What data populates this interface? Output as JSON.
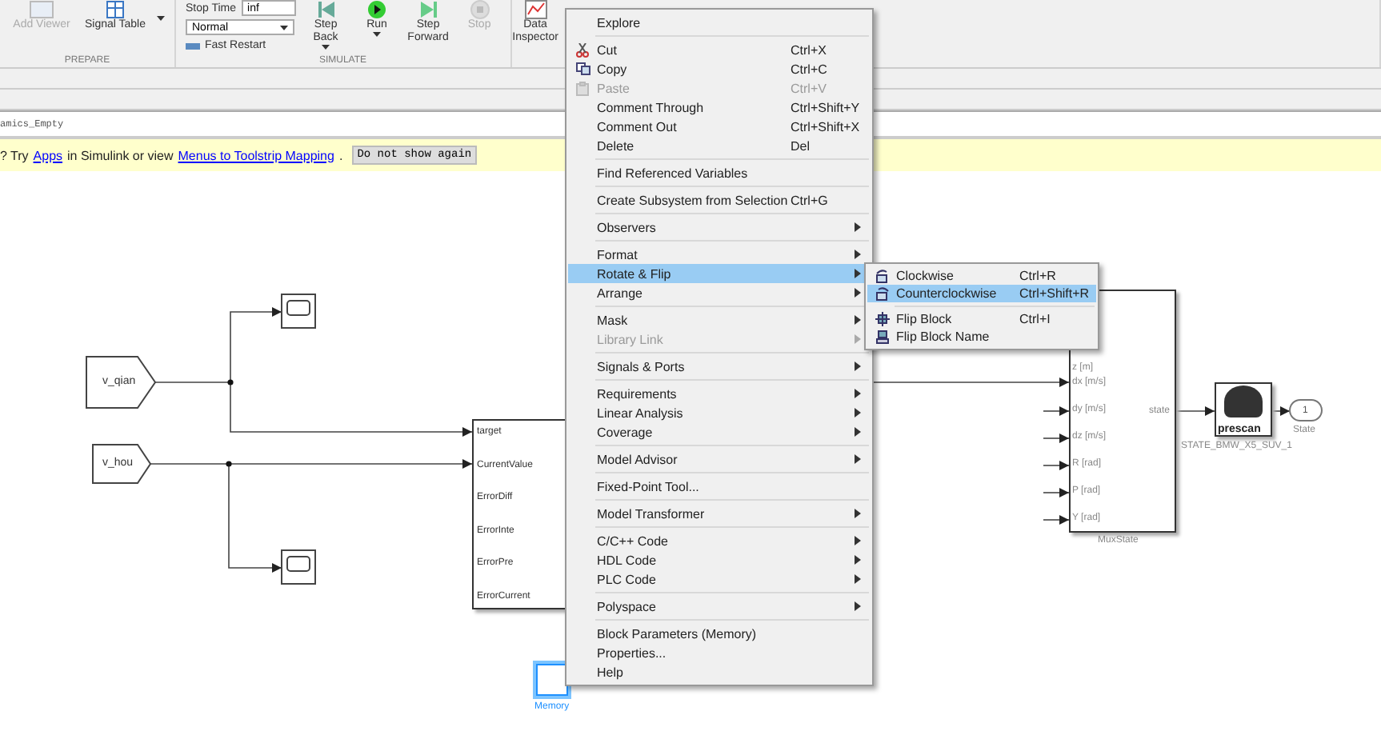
{
  "toolstrip": {
    "prepare": {
      "label": "PREPARE",
      "buttons": [
        {
          "label": "Add Viewer",
          "disabled": true,
          "kind": "viewer"
        },
        {
          "label": "Signal Table",
          "disabled": false,
          "kind": "table"
        }
      ]
    },
    "simulate": {
      "label": "SIMULATE",
      "stop_time_label": "Stop Time",
      "stop_time": "inf",
      "mode": "Normal",
      "fast_restart": "Fast Restart",
      "buttons": [
        {
          "label": "Step Back",
          "disabled": false,
          "kind": "back",
          "dropdown": true
        },
        {
          "label": "Run",
          "disabled": false,
          "kind": "run",
          "dropdown": true
        },
        {
          "label": "Step Forward",
          "disabled": false,
          "kind": "forward",
          "dropdown": false
        },
        {
          "label": "Stop",
          "disabled": true,
          "kind": "stop",
          "dropdown": false
        }
      ]
    },
    "review": {
      "buttons": [
        {
          "label": "Data Inspector",
          "disabled": false,
          "kind": "inspector"
        }
      ]
    }
  },
  "breadcrumb": "amics_Empty",
  "banner": {
    "before": "? Try",
    "link_1": "Apps",
    "middle": "in Simulink or view",
    "link_2": "Menus to Toolstrip Mapping",
    "after": ".",
    "button": "Do not show again"
  },
  "diagram": {
    "from_blocks": [
      {
        "label": "v_qian"
      },
      {
        "label": "v_hou"
      }
    ],
    "subsystem": {
      "ports": [
        "target",
        "CurrentValue",
        "ErrorDiff",
        "ErrorInte",
        "ErrorPre",
        "ErrorCurrent"
      ]
    },
    "memory": {
      "label": "Memory",
      "selected": true
    },
    "mux": {
      "label": "MuxState",
      "ports": [
        "z [m]",
        "dx [m/s]",
        "dy [m/s]",
        "dz [m/s]",
        "R [rad]",
        "P [rad]",
        "Y [rad]"
      ],
      "output": "state"
    },
    "prescan": {
      "logo": "prescan",
      "label": "STATE_BMW_X5_SUV_1"
    },
    "outport": {
      "number": "1",
      "label": "State"
    }
  },
  "context_menu": [
    [
      {
        "label": "Explore",
        "kind": "plain",
        "disabled": false,
        "submenu": false,
        "selected": false
      }
    ],
    [
      {
        "label": "Cut",
        "shortcut": "Ctrl+X",
        "kind": "cut",
        "disabled": false,
        "submenu": false,
        "selected": false
      },
      {
        "label": "Copy",
        "shortcut": "Ctrl+C",
        "kind": "copy",
        "disabled": false,
        "submenu": false,
        "selected": false
      },
      {
        "label": "Paste",
        "shortcut": "Ctrl+V",
        "kind": "paste",
        "disabled": true,
        "submenu": false,
        "selected": false
      },
      {
        "label": "Comment Through",
        "shortcut": "Ctrl+Shift+Y",
        "kind": "plain",
        "disabled": false,
        "submenu": false,
        "selected": false
      },
      {
        "label": "Comment Out",
        "shortcut": "Ctrl+Shift+X",
        "kind": "plain",
        "disabled": false,
        "submenu": false,
        "selected": false
      },
      {
        "label": "Delete",
        "shortcut": "Del",
        "kind": "plain",
        "disabled": false,
        "submenu": false,
        "selected": false
      }
    ],
    [
      {
        "label": "Find Referenced Variables",
        "kind": "plain",
        "disabled": false,
        "submenu": false,
        "selected": false
      }
    ],
    [
      {
        "label": "Create Subsystem from Selection",
        "shortcut": "Ctrl+G",
        "kind": "plain",
        "disabled": false,
        "submenu": false,
        "selected": false
      }
    ],
    [
      {
        "label": "Observers",
        "kind": "plain",
        "disabled": false,
        "submenu": true,
        "selected": false
      }
    ],
    [
      {
        "label": "Format",
        "kind": "plain",
        "disabled": false,
        "submenu": true,
        "selected": false
      },
      {
        "label": "Rotate & Flip",
        "kind": "plain",
        "disabled": false,
        "submenu": true,
        "selected": true
      },
      {
        "label": "Arrange",
        "kind": "plain",
        "disabled": false,
        "submenu": true,
        "selected": false
      }
    ],
    [
      {
        "label": "Mask",
        "kind": "plain",
        "disabled": false,
        "submenu": true,
        "selected": false
      },
      {
        "label": "Library Link",
        "kind": "plain",
        "disabled": true,
        "submenu": true,
        "selected": false
      }
    ],
    [
      {
        "label": "Signals & Ports",
        "kind": "plain",
        "disabled": false,
        "submenu": true,
        "selected": false
      }
    ],
    [
      {
        "label": "Requirements",
        "kind": "plain",
        "disabled": false,
        "submenu": true,
        "selected": false
      },
      {
        "label": "Linear Analysis",
        "kind": "plain",
        "disabled": false,
        "submenu": true,
        "selected": false
      },
      {
        "label": "Coverage",
        "kind": "plain",
        "disabled": false,
        "submenu": true,
        "selected": false
      }
    ],
    [
      {
        "label": "Model Advisor",
        "kind": "plain",
        "disabled": false,
        "submenu": true,
        "selected": false
      }
    ],
    [
      {
        "label": "Fixed-Point Tool...",
        "kind": "plain",
        "disabled": false,
        "submenu": false,
        "selected": false
      }
    ],
    [
      {
        "label": "Model Transformer",
        "kind": "plain",
        "disabled": false,
        "submenu": true,
        "selected": false
      }
    ],
    [
      {
        "label": "C/C++ Code",
        "kind": "plain",
        "disabled": false,
        "submenu": true,
        "selected": false
      },
      {
        "label": "HDL Code",
        "kind": "plain",
        "disabled": false,
        "submenu": true,
        "selected": false
      },
      {
        "label": "PLC Code",
        "kind": "plain",
        "disabled": false,
        "submenu": true,
        "selected": false
      }
    ],
    [
      {
        "label": "Polyspace",
        "kind": "plain",
        "disabled": false,
        "submenu": true,
        "selected": false
      }
    ],
    [
      {
        "label": "Block Parameters (Memory)",
        "kind": "plain",
        "disabled": false,
        "submenu": false,
        "selected": false
      },
      {
        "label": "Properties...",
        "kind": "plain",
        "disabled": false,
        "submenu": false,
        "selected": false
      },
      {
        "label": "Help",
        "kind": "plain",
        "disabled": false,
        "submenu": false,
        "selected": false
      }
    ]
  ],
  "submenu": [
    [
      {
        "label": "Clockwise",
        "shortcut": "Ctrl+R",
        "kind": "cw",
        "selected": false
      },
      {
        "label": "Counterclockwise",
        "shortcut": "Ctrl+Shift+R",
        "kind": "ccw",
        "selected": true
      }
    ],
    [
      {
        "label": "Flip Block",
        "shortcut": "Ctrl+I",
        "kind": "flip",
        "selected": false
      },
      {
        "label": "Flip Block Name",
        "kind": "flipname",
        "selected": false
      }
    ]
  ]
}
